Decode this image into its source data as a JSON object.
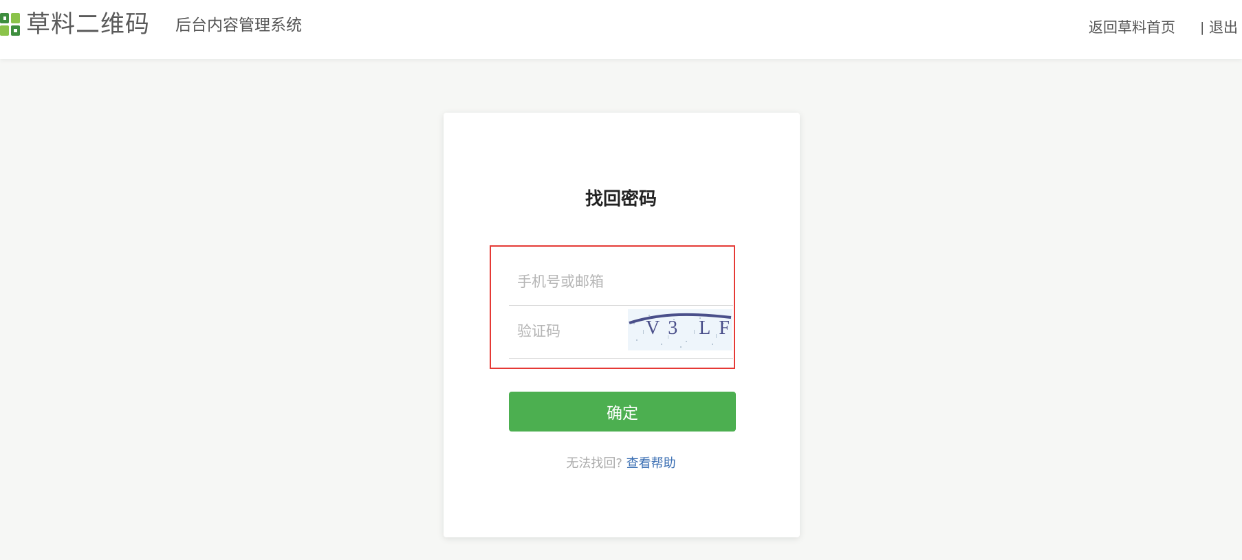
{
  "header": {
    "brand": "草料二维码",
    "system_title": "后台内容管理系统",
    "nav_home": "返回草料首页",
    "nav_separator": "|",
    "nav_logout": "退出"
  },
  "form": {
    "title": "找回密码",
    "phone_placeholder": "手机号或邮箱",
    "code_placeholder": "验证码",
    "captcha_text": "V3 LF",
    "submit_label": "确定",
    "help_prefix": "无法找回?",
    "help_link": "查看帮助"
  },
  "colors": {
    "accent": "#4caf50",
    "link": "#3b6fb3",
    "highlight": "#e53935",
    "logo_dark": "#3e8e3e",
    "logo_light": "#8bc34a"
  },
  "icons": {
    "logo": "caoliao-qr-logo-icon",
    "captcha": "captcha-image"
  }
}
